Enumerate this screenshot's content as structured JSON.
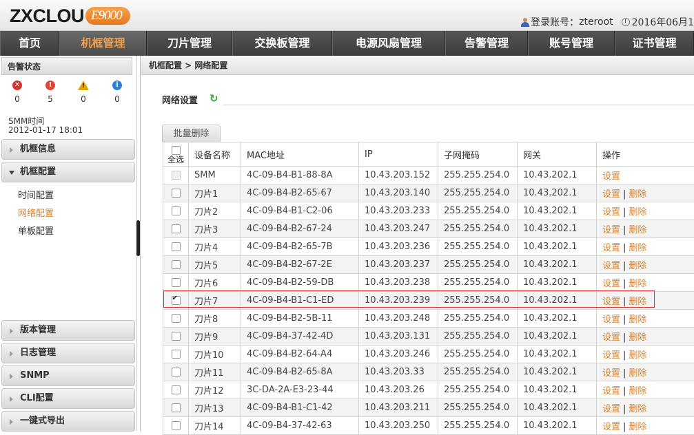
{
  "header": {
    "logo_text": "ZXCLOU",
    "logo_badge": "E9000",
    "login_label": "登录账号：",
    "username": "zteroot",
    "datetime": "2016年06月1"
  },
  "nav": {
    "items": [
      {
        "label": "首页",
        "active": false
      },
      {
        "label": "机框管理",
        "active": true
      },
      {
        "label": "刀片管理",
        "active": false
      },
      {
        "label": "交换板管理",
        "active": false
      },
      {
        "label": "电源风扇管理",
        "active": false
      },
      {
        "label": "告警管理",
        "active": false
      },
      {
        "label": "账号管理",
        "active": false
      },
      {
        "label": "证书管理",
        "active": false
      }
    ]
  },
  "sidebar": {
    "alarm_title": "告警状态",
    "alarms": [
      {
        "icon": "critical-alarm-icon",
        "count": "0",
        "color": "#d9312b"
      },
      {
        "icon": "major-alarm-icon",
        "count": "5",
        "color": "#e2463b"
      },
      {
        "icon": "minor-alarm-icon",
        "count": "0",
        "color": "#e8a200"
      },
      {
        "icon": "info-alarm-icon",
        "count": "0",
        "color": "#2f7fd3"
      }
    ],
    "smm_label": "SMM时间",
    "smm_time": "2012-01-17 18:01",
    "menus": [
      {
        "label": "机框信息",
        "expanded": false
      },
      {
        "label": "机框配置",
        "expanded": true
      },
      {
        "label": "版本管理",
        "expanded": false
      },
      {
        "label": "日志管理",
        "expanded": false
      },
      {
        "label": "SNMP",
        "expanded": false
      },
      {
        "label": "CLI配置",
        "expanded": false
      },
      {
        "label": "一键式导出",
        "expanded": false
      }
    ],
    "submenu": [
      {
        "label": "时间配置",
        "active": false
      },
      {
        "label": "网络配置",
        "active": true
      },
      {
        "label": "单板配置",
        "active": false
      }
    ]
  },
  "content": {
    "breadcrumb": "机框配置 > 网络配置",
    "section_title": "网络设置",
    "batch_delete": "批量删除",
    "table": {
      "select_all": "全选",
      "columns": [
        "设备名称",
        "MAC地址",
        "IP",
        "子网掩码",
        "网关",
        "操作"
      ],
      "op_set": "设置",
      "op_delete": "删除",
      "rows": [
        {
          "name": "SMM",
          "mac": "4C-09-B4-B1-88-8A",
          "ip": "10.43.203.152",
          "mask": "255.255.254.0",
          "gw": "10.43.202.1",
          "deletable": false,
          "checked": false,
          "disabled": true
        },
        {
          "name": "刀片1",
          "mac": "4C-09-B4-B2-65-67",
          "ip": "10.43.203.140",
          "mask": "255.255.254.0",
          "gw": "10.43.202.1",
          "deletable": true,
          "checked": false,
          "disabled": false
        },
        {
          "name": "刀片2",
          "mac": "4C-09-B4-B1-C2-06",
          "ip": "10.43.203.233",
          "mask": "255.255.254.0",
          "gw": "10.43.202.1",
          "deletable": true,
          "checked": false,
          "disabled": false
        },
        {
          "name": "刀片3",
          "mac": "4C-09-B4-B2-67-24",
          "ip": "10.43.203.247",
          "mask": "255.255.254.0",
          "gw": "10.43.202.1",
          "deletable": true,
          "checked": false,
          "disabled": false
        },
        {
          "name": "刀片4",
          "mac": "4C-09-B4-B2-65-7B",
          "ip": "10.43.203.236",
          "mask": "255.255.254.0",
          "gw": "10.43.202.1",
          "deletable": true,
          "checked": false,
          "disabled": false
        },
        {
          "name": "刀片5",
          "mac": "4C-09-B4-B2-67-2E",
          "ip": "10.43.203.237",
          "mask": "255.255.254.0",
          "gw": "10.43.202.1",
          "deletable": true,
          "checked": false,
          "disabled": false
        },
        {
          "name": "刀片6",
          "mac": "4C-09-B4-B2-59-DB",
          "ip": "10.43.203.238",
          "mask": "255.255.254.0",
          "gw": "10.43.202.1",
          "deletable": true,
          "checked": false,
          "disabled": false
        },
        {
          "name": "刀片7",
          "mac": "4C-09-B4-B1-C1-ED",
          "ip": "10.43.203.239",
          "mask": "255.255.254.0",
          "gw": "10.43.202.1",
          "deletable": true,
          "checked": true,
          "disabled": false
        },
        {
          "name": "刀片8",
          "mac": "4C-09-B4-B2-5B-11",
          "ip": "10.43.203.248",
          "mask": "255.255.254.0",
          "gw": "10.43.202.1",
          "deletable": true,
          "checked": false,
          "disabled": false
        },
        {
          "name": "刀片9",
          "mac": "4C-09-B4-37-42-4D",
          "ip": "10.43.203.131",
          "mask": "255.255.254.0",
          "gw": "10.43.202.1",
          "deletable": true,
          "checked": false,
          "disabled": false
        },
        {
          "name": "刀片10",
          "mac": "4C-09-B4-B2-64-A4",
          "ip": "10.43.203.246",
          "mask": "255.255.254.0",
          "gw": "10.43.202.1",
          "deletable": true,
          "checked": false,
          "disabled": false
        },
        {
          "name": "刀片11",
          "mac": "4C-09-B4-B2-65-8A",
          "ip": "10.43.203.33",
          "mask": "255.255.254.0",
          "gw": "10.43.202.1",
          "deletable": true,
          "checked": false,
          "disabled": false
        },
        {
          "name": "刀片12",
          "mac": "3C-DA-2A-E3-23-44",
          "ip": "10.43.203.26",
          "mask": "255.255.254.0",
          "gw": "10.43.202.1",
          "deletable": true,
          "checked": false,
          "disabled": false
        },
        {
          "name": "刀片13",
          "mac": "4C-09-B4-B1-C1-42",
          "ip": "10.43.203.211",
          "mask": "255.255.254.0",
          "gw": "10.43.202.1",
          "deletable": true,
          "checked": false,
          "disabled": false
        },
        {
          "name": "刀片14",
          "mac": "4C-09-B4-37-42-63",
          "ip": "10.43.203.250",
          "mask": "255.255.254.0",
          "gw": "10.43.202.1",
          "deletable": true,
          "checked": false,
          "disabled": false
        }
      ]
    }
  }
}
